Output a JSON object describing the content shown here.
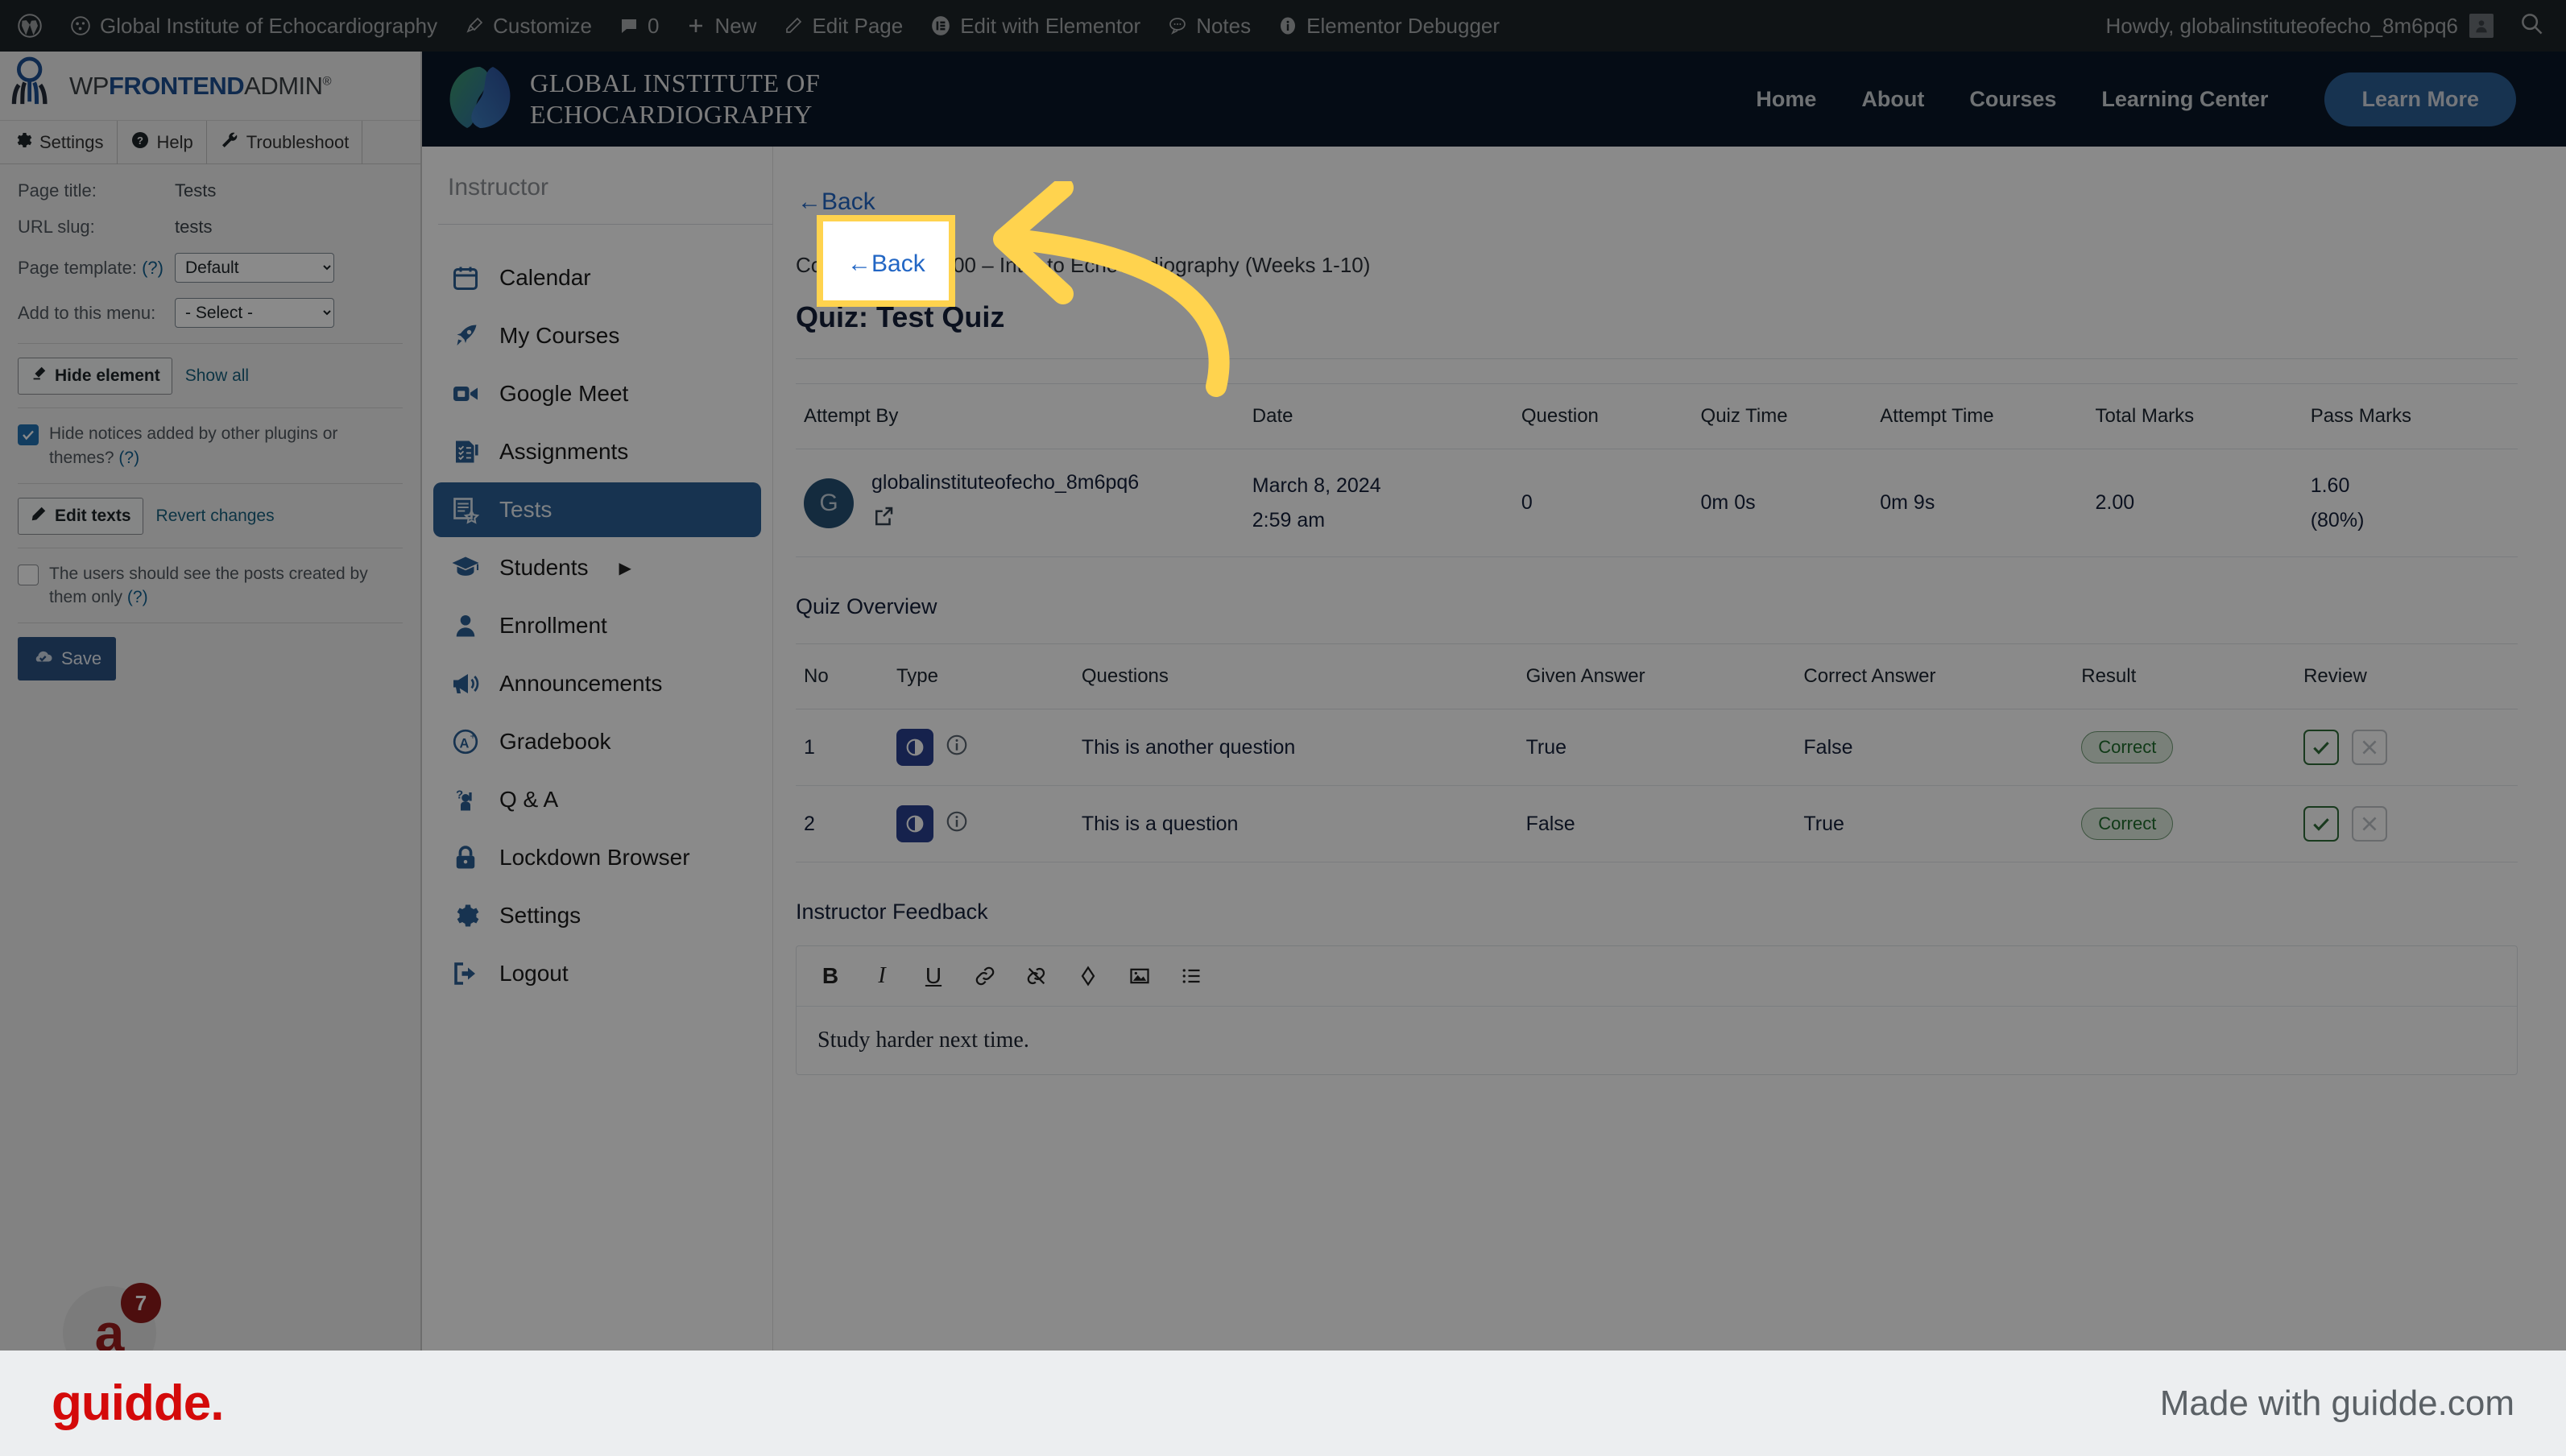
{
  "adminbar": {
    "site_name": "Global Institute of Echocardiography",
    "customize": "Customize",
    "comments_count": "0",
    "new": "New",
    "edit_page": "Edit Page",
    "edit_elementor": "Edit with Elementor",
    "notes": "Notes",
    "debugger": "Elementor Debugger",
    "howdy": "Howdy, globalinstituteofecho_8m6pq6"
  },
  "frontend_admin": {
    "logo_pre": "WP",
    "logo_mid": "FRONTEND",
    "logo_post": "ADMIN",
    "logo_reg": "®",
    "tabs": [
      {
        "label": "Settings",
        "icon": "gear-icon"
      },
      {
        "label": "Help",
        "icon": "question-circle-icon"
      },
      {
        "label": "Troubleshoot",
        "icon": "wrench-icon"
      }
    ],
    "fields": {
      "page_title_label": "Page title:",
      "page_title_value": "Tests",
      "url_slug_label": "URL slug:",
      "url_slug_value": "tests",
      "page_template_label": "Page template:",
      "page_template_help": "(?)",
      "page_template_value": "Default",
      "add_menu_label": "Add to this menu:",
      "add_menu_value": "- Select -"
    },
    "hide_element": "Hide element",
    "show_all": "Show all",
    "hide_notices": "Hide notices added by other plugins or themes?",
    "hide_notices_help": "(?)",
    "hide_notices_checked": true,
    "edit_texts": "Edit texts",
    "revert_changes": "Revert changes",
    "users_posts_only": "The users should see the posts created by them only",
    "users_posts_only_help": "(?)",
    "users_posts_only_checked": false,
    "save": "Save",
    "chat_badge": "7"
  },
  "site_header": {
    "brand_line1": "GLOBAL INSTITUTE OF",
    "brand_line2": "ECHOCARDIOGRAPHY",
    "nav": [
      {
        "label": "Home"
      },
      {
        "label": "About"
      },
      {
        "label": "Courses"
      },
      {
        "label": "Learning Center"
      }
    ],
    "cta": "Learn More"
  },
  "instructor_menu": {
    "title": "Instructor",
    "items": [
      {
        "label": "Calendar",
        "icon": "calendar-icon",
        "active": false
      },
      {
        "label": "My Courses",
        "icon": "rocket-icon",
        "active": false
      },
      {
        "label": "Google Meet",
        "icon": "video-camera-icon",
        "active": false
      },
      {
        "label": "Assignments",
        "icon": "checklist-icon",
        "active": false
      },
      {
        "label": "Tests",
        "icon": "certificate-icon",
        "active": true
      },
      {
        "label": "Students",
        "icon": "graduation-cap-icon",
        "active": false,
        "has_submenu": true
      },
      {
        "label": "Enrollment",
        "icon": "person-icon",
        "active": false
      },
      {
        "label": "Announcements",
        "icon": "megaphone-icon",
        "active": false
      },
      {
        "label": "Gradebook",
        "icon": "grade-a-icon",
        "active": false
      },
      {
        "label": "Q & A",
        "icon": "question-person-icon",
        "active": false
      },
      {
        "label": "Lockdown Browser",
        "icon": "lock-icon",
        "active": false
      },
      {
        "label": "Settings",
        "icon": "gear-icon",
        "active": false
      },
      {
        "label": "Logout",
        "icon": "logout-icon",
        "active": false
      }
    ]
  },
  "main": {
    "back_label": "Back",
    "back_arrow": "←",
    "course_line": "Course: ECHO 100 – Intro to Echocardiography (Weeks 1-10)",
    "quiz_title": "Quiz: Test Quiz",
    "attempt_table": {
      "headers": [
        "Attempt By",
        "Date",
        "Question",
        "Quiz Time",
        "Attempt Time",
        "Total Marks",
        "Pass Marks"
      ],
      "rows": [
        {
          "avatar_letter": "G",
          "attempt_by": "globalinstituteofecho_8m6pq6",
          "date_line1": "March 8, 2024",
          "date_line2": "2:59 am",
          "question": "0",
          "quiz_time": "0m 0s",
          "attempt_time": "0m 9s",
          "total_marks": "2.00",
          "pass_marks_line1": "1.60",
          "pass_marks_line2": "(80%)"
        }
      ]
    },
    "overview_title": "Quiz Overview",
    "overview_table": {
      "headers": [
        "No",
        "Type",
        "Questions",
        "Given Answer",
        "Correct Answer",
        "Result",
        "Review"
      ],
      "rows": [
        {
          "no": "1",
          "type_icon": "true-false-icon",
          "info_icon": "info-circle-icon",
          "question": "This is another question",
          "given_answer": "True",
          "correct_answer": "False",
          "result": "Correct",
          "review_yes": "✓",
          "review_no": "✕"
        },
        {
          "no": "2",
          "type_icon": "true-false-icon",
          "info_icon": "info-circle-icon",
          "question": "This is a question",
          "given_answer": "False",
          "correct_answer": "True",
          "result": "Correct",
          "review_yes": "✓",
          "review_no": "✕"
        }
      ]
    },
    "feedback_title": "Instructor Feedback",
    "editor_toolbar": [
      {
        "name": "bold-icon",
        "glyph": "B"
      },
      {
        "name": "italic-icon",
        "glyph": "I"
      },
      {
        "name": "underline-icon",
        "glyph": "U"
      },
      {
        "name": "link-icon",
        "glyph": "🔗"
      },
      {
        "name": "unlink-icon",
        "glyph": "⛓"
      },
      {
        "name": "highlight-icon",
        "glyph": "◇"
      },
      {
        "name": "image-icon",
        "glyph": "🖼"
      },
      {
        "name": "list-icon",
        "glyph": "☰"
      }
    ],
    "feedback_text": "Study harder next time."
  },
  "guidde": {
    "logo": "guidde.",
    "tagline": "Made with guidde.com"
  },
  "colors": {
    "wp_bar": "#1d2327",
    "site_header": "#0b1728",
    "accent_blue": "#2c5f94",
    "highlight_yellow": "#ffd34e",
    "guidde_red": "#d40a0a",
    "correct_green": "#1f6b2c"
  }
}
